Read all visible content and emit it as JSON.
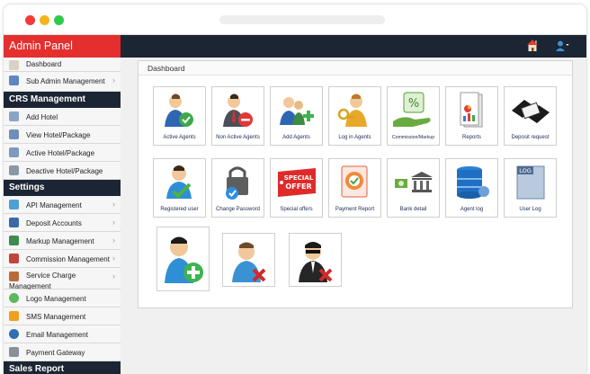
{
  "app": {
    "brand": "Admin Panel"
  },
  "topbar": {
    "icons": [
      "home-icon",
      "user-icon"
    ]
  },
  "sidebar": {
    "items_top": [
      {
        "label": "Dashboard",
        "icon": "home-icon",
        "chevron": false
      },
      {
        "label": "Sub Admin Management",
        "icon": "users-icon",
        "chevron": true
      }
    ],
    "section_crs": "CRS Management",
    "items_crs": [
      {
        "label": "Add Hotel",
        "icon": "hotel-icon"
      },
      {
        "label": "View Hotel/Package",
        "icon": "hotel-view-icon"
      },
      {
        "label": "Active Hotel/Package",
        "icon": "hotel-active-icon"
      },
      {
        "label": "Deactive Hotel/Package",
        "icon": "hotel-deactive-icon"
      }
    ],
    "section_settings": "Settings",
    "items_settings": [
      {
        "label": "API Management",
        "icon": "api-icon",
        "chevron": true
      },
      {
        "label": "Deposit Accounts",
        "icon": "deposit-icon",
        "chevron": true
      },
      {
        "label": "Markup Management",
        "icon": "markup-icon",
        "chevron": true
      },
      {
        "label": "Commission Management",
        "icon": "commission-icon",
        "chevron": true
      },
      {
        "label": "Service Charge",
        "label2": "Management",
        "icon": "service-icon",
        "chevron": true
      },
      {
        "label": "Logo Management",
        "icon": "logo-icon",
        "chevron": false
      },
      {
        "label": "SMS Management",
        "icon": "sms-icon",
        "chevron": false
      },
      {
        "label": "Email Management",
        "icon": "email-icon",
        "chevron": false
      },
      {
        "label": "Payment Gateway",
        "icon": "payment-icon",
        "chevron": false
      }
    ],
    "section_sales": "Sales Report"
  },
  "main": {
    "panel_title": "Dashboard",
    "row1": [
      {
        "label": "Active Agents",
        "icon": "active-agents-icon"
      },
      {
        "label": "Non Active Agents",
        "icon": "non-active-agents-icon"
      },
      {
        "label": "Add Agents",
        "icon": "add-agents-icon"
      },
      {
        "label": "Log in Agents",
        "icon": "login-agents-icon"
      },
      {
        "label": "Commission/Markup",
        "icon": "commission-markup-icon"
      },
      {
        "label": "Reports",
        "icon": "reports-icon"
      },
      {
        "label": "Deposit request",
        "icon": "deposit-request-icon"
      }
    ],
    "row2": [
      {
        "label": "Registered user",
        "icon": "registered-user-icon"
      },
      {
        "label": "Change Password",
        "icon": "change-password-icon"
      },
      {
        "label": "Special offers",
        "icon": "special-offers-icon",
        "badge_line1": "SPECIAL",
        "badge_line2": "OFFER"
      },
      {
        "label": "Payment Report",
        "icon": "payment-report-icon"
      },
      {
        "label": "Bank detail",
        "icon": "bank-detail-icon"
      },
      {
        "label": "Agent log",
        "icon": "agent-log-icon"
      },
      {
        "label": "User Log",
        "icon": "user-log-icon",
        "badge": "LOG"
      }
    ],
    "row3": [
      {
        "icon": "add-user-icon"
      },
      {
        "icon": "remove-user-icon"
      },
      {
        "icon": "block-agent-icon"
      }
    ]
  },
  "colors": {
    "brand_red": "#e52e2e",
    "dark_bar": "#1c2533",
    "caption_text": "#1d2a52"
  }
}
